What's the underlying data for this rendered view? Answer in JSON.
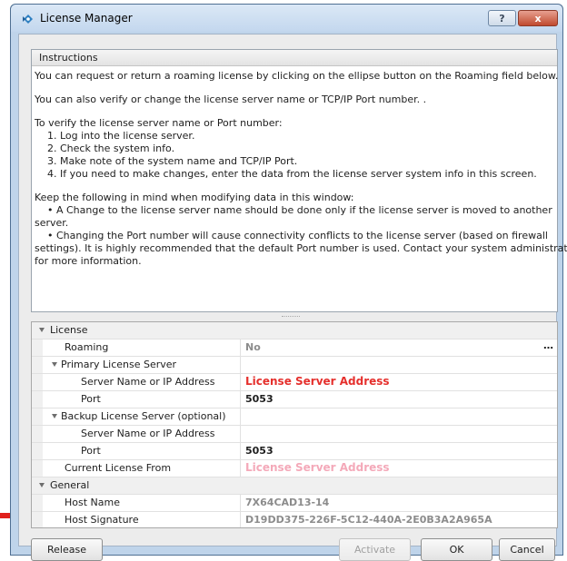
{
  "window": {
    "title": "License Manager",
    "help_label": "?",
    "close_label": "x"
  },
  "instructions": {
    "header": "Instructions",
    "lines": [
      "You can request or return a roaming license by clicking on the ellipse button on the Roaming field below.",
      "",
      "You can also verify or change the license server name or TCP/IP Port number. .",
      "",
      "To verify the license server name or Port number:",
      "    1. Log into the license server.",
      "    2. Check the system info.",
      "    3. Make note of the system name and TCP/IP Port.",
      "    4. If you need to make changes, enter the data from the license server system info in this screen.",
      "",
      "Keep the following in mind when modifying data in this window:",
      "    • A Change to the license server name should be done only if the license server is moved to another",
      "server.",
      "    • Changing the Port number will cause connectivity conflicts to the license server (based on firewall",
      "settings). It is highly recommended that the default Port number is used. Contact your system administrator",
      "for more information."
    ]
  },
  "grid": {
    "rows": [
      {
        "label": "License",
        "value": "",
        "level": 0,
        "category": true,
        "expander": true
      },
      {
        "label": "Roaming",
        "value": "No",
        "level": 2,
        "style": "grayb",
        "ellipsis": "…"
      },
      {
        "label": "Primary License Server",
        "value": "",
        "level": 1,
        "expander": true
      },
      {
        "label": "Server Name or IP Address",
        "value": "License Server Address",
        "level": 3,
        "style": "red"
      },
      {
        "label": "Port",
        "value": "5053",
        "level": 3,
        "style": "bold"
      },
      {
        "label": "Backup License Server (optional)",
        "value": "",
        "level": 1,
        "expander": true
      },
      {
        "label": "Server Name or IP Address",
        "value": "",
        "level": 3
      },
      {
        "label": "Port",
        "value": "5053",
        "level": 3,
        "style": "bold"
      },
      {
        "label": "Current License From",
        "value": "License Server Address",
        "level": 2,
        "style": "pink"
      },
      {
        "label": "General",
        "value": "",
        "level": 0,
        "category": true,
        "expander": true
      },
      {
        "label": "Host Name",
        "value": "7X64CAD13-14",
        "level": 2,
        "style": "grayb"
      },
      {
        "label": "Host Signature",
        "value": "D19DD375-226F-5C12-440A-2E0B3A2A965A",
        "level": 2,
        "style": "grayb"
      }
    ]
  },
  "buttons": {
    "release": "Release",
    "activate": "Activate",
    "ok": "OK",
    "cancel": "Cancel"
  },
  "colors": {
    "highlight_red": "#e5302d",
    "faded_pink": "#f4a9b9",
    "arrow_red": "#e0201c"
  }
}
